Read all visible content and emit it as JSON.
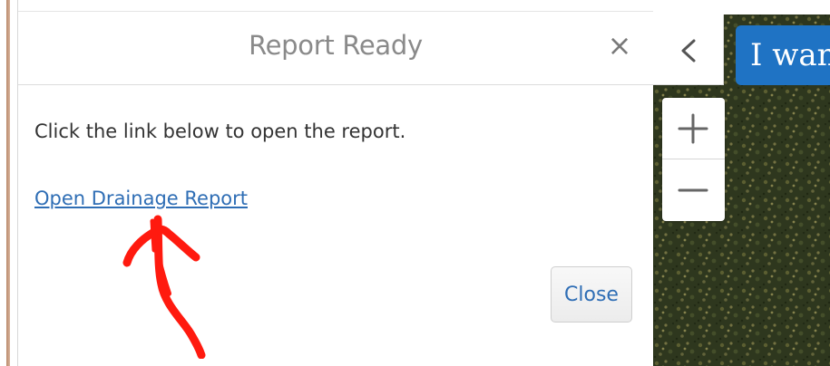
{
  "dialog": {
    "title": "Report Ready",
    "close_icon": "close-icon",
    "message": "Click the link below to open the report.",
    "link_text": "Open Drainage Report",
    "close_button_label": "Close"
  },
  "map": {
    "collapse_icon": "chevron-left-icon",
    "search_banner_text": "I wan",
    "zoom_in_icon": "plus-icon",
    "zoom_out_icon": "minus-icon"
  },
  "annotation": {
    "type": "hand-drawn-arrow-up",
    "color": "#ff0000"
  },
  "colors": {
    "link": "#2f6eb5",
    "title": "#8a8a8a",
    "banner": "#1f73c4",
    "map_dark": "#343d24"
  }
}
